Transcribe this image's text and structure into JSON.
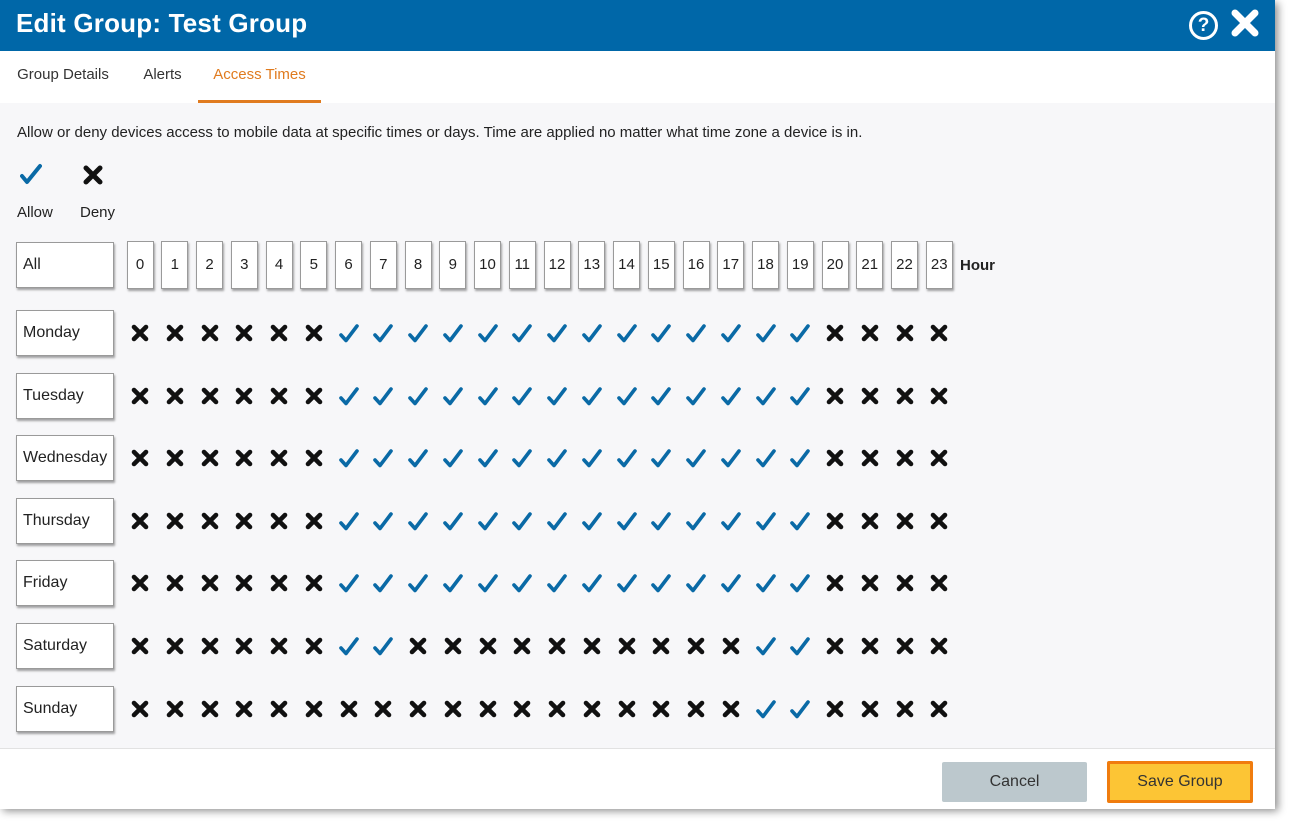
{
  "window": {
    "title": "Edit Group: Test Group",
    "help_icon": "question-circle-icon",
    "close_icon": "close-icon"
  },
  "tabs": [
    {
      "label": "Group Details",
      "active": false
    },
    {
      "label": "Alerts",
      "active": false
    },
    {
      "label": "Access Times",
      "active": true
    }
  ],
  "description": "Allow or deny devices access to mobile data at specific times or days. Time are applied no matter what time zone a device is in.",
  "legend": {
    "allow_label": "Allow",
    "deny_label": "Deny"
  },
  "grid": {
    "all_label": "All",
    "hour_label": "Hour",
    "hours": [
      "0",
      "1",
      "2",
      "3",
      "4",
      "5",
      "6",
      "7",
      "8",
      "9",
      "10",
      "11",
      "12",
      "13",
      "14",
      "15",
      "16",
      "17",
      "18",
      "19",
      "20",
      "21",
      "22",
      "23"
    ],
    "days": [
      {
        "label": "Monday",
        "allowed": [
          0,
          0,
          0,
          0,
          0,
          0,
          1,
          1,
          1,
          1,
          1,
          1,
          1,
          1,
          1,
          1,
          1,
          1,
          1,
          1,
          0,
          0,
          0,
          0
        ]
      },
      {
        "label": "Tuesday",
        "allowed": [
          0,
          0,
          0,
          0,
          0,
          0,
          1,
          1,
          1,
          1,
          1,
          1,
          1,
          1,
          1,
          1,
          1,
          1,
          1,
          1,
          0,
          0,
          0,
          0
        ]
      },
      {
        "label": "Wednesday",
        "allowed": [
          0,
          0,
          0,
          0,
          0,
          0,
          1,
          1,
          1,
          1,
          1,
          1,
          1,
          1,
          1,
          1,
          1,
          1,
          1,
          1,
          0,
          0,
          0,
          0
        ]
      },
      {
        "label": "Thursday",
        "allowed": [
          0,
          0,
          0,
          0,
          0,
          0,
          1,
          1,
          1,
          1,
          1,
          1,
          1,
          1,
          1,
          1,
          1,
          1,
          1,
          1,
          0,
          0,
          0,
          0
        ]
      },
      {
        "label": "Friday",
        "allowed": [
          0,
          0,
          0,
          0,
          0,
          0,
          1,
          1,
          1,
          1,
          1,
          1,
          1,
          1,
          1,
          1,
          1,
          1,
          1,
          1,
          0,
          0,
          0,
          0
        ]
      },
      {
        "label": "Saturday",
        "allowed": [
          0,
          0,
          0,
          0,
          0,
          0,
          1,
          1,
          0,
          0,
          0,
          0,
          0,
          0,
          0,
          0,
          0,
          0,
          1,
          1,
          0,
          0,
          0,
          0
        ]
      },
      {
        "label": "Sunday",
        "allowed": [
          0,
          0,
          0,
          0,
          0,
          0,
          0,
          0,
          0,
          0,
          0,
          0,
          0,
          0,
          0,
          0,
          0,
          0,
          1,
          1,
          0,
          0,
          0,
          0
        ]
      }
    ]
  },
  "footer": {
    "cancel_label": "Cancel",
    "save_label": "Save Group"
  },
  "colors": {
    "header": "#0067a8",
    "accent": "#e07b1f",
    "allow": "#0a6aa6",
    "deny": "#111111",
    "save": "#fcc535",
    "save_border": "#f07c0e",
    "cancel": "#bcc8cd"
  }
}
